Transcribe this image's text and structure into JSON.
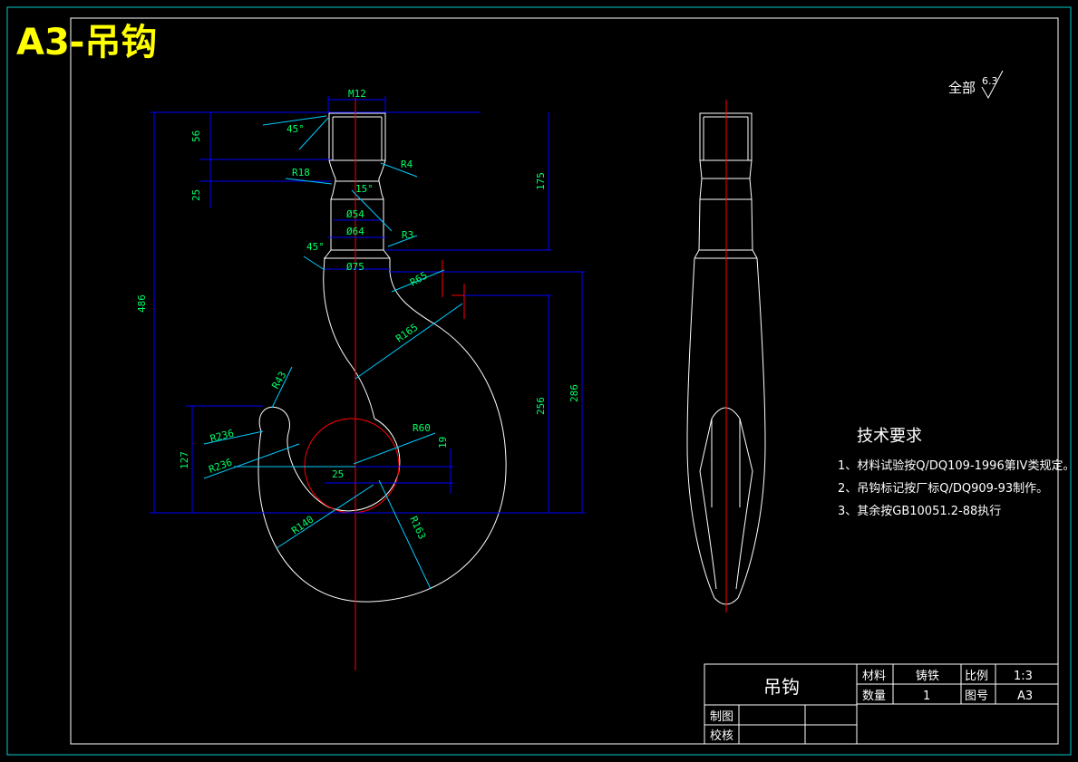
{
  "sheet_title": "A3-吊钩",
  "surface_note": {
    "prefix": "全部",
    "roughness": "6.3"
  },
  "dimensions": {
    "m12": "M12",
    "a45_top": "45°",
    "d56": "56",
    "r18": "R18",
    "r4": "R4",
    "a15": "15°",
    "d25_left": "25",
    "phi54": "Ø54",
    "phi64": "Ø64",
    "r3": "R3",
    "a45_mid": "45°",
    "phi75": "Ø75",
    "r65": "R65",
    "d175": "175",
    "d486": "486",
    "r165": "R165",
    "r43": "R43",
    "r236a": "R236",
    "r236b": "R236",
    "d127": "127",
    "r60": "R60",
    "d19": "19",
    "d25_mid": "25",
    "d256": "256",
    "d286": "286",
    "r140": "R140",
    "r163": "R163"
  },
  "tech_requirements": {
    "title": "技术要求",
    "items": [
      "1、材料试验按Q/DQ109-1996第IV类规定。",
      "2、吊钩标记按厂标Q/DQ909-93制作。",
      "3、其余按GB10051.2-88执行"
    ]
  },
  "title_block": {
    "part_name": "吊钩",
    "material_label": "材料",
    "material_value": "铸铁",
    "scale_label": "比例",
    "scale_value": "1:3",
    "qty_label": "数量",
    "qty_value": "1",
    "drawing_no_label": "图号",
    "drawing_no_value": "A3",
    "drawn_label": "制图",
    "checked_label": "校核"
  },
  "colors": {
    "background": "#000000",
    "outline": "#ffffff",
    "centerline": "#ff0000",
    "dimension_line": "#0000ff",
    "extension_line": "#00ccff",
    "dimension_text": "#00ff66",
    "frame": "#00cccc",
    "title": "#ffff00"
  }
}
